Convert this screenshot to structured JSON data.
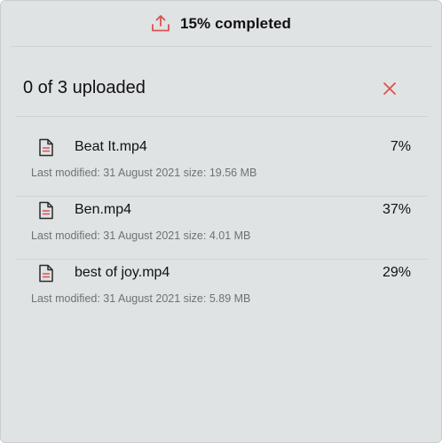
{
  "header": {
    "icon": "upload-icon",
    "title": "15% completed",
    "accent_color": "#d9534f"
  },
  "summary": {
    "text": "0 of 3 uploaded",
    "close_icon": "close-icon"
  },
  "files": [
    {
      "icon": "document-icon",
      "name": "Beat It.mp4",
      "percent": "7%",
      "meta": "Last modified: 31 August 2021 size: 19.56 MB"
    },
    {
      "icon": "document-icon",
      "name": "Ben.mp4",
      "percent": "37%",
      "meta": "Last modified: 31 August 2021 size: 4.01 MB"
    },
    {
      "icon": "document-icon",
      "name": "best of joy.mp4",
      "percent": "29%",
      "meta": "Last modified: 31 August 2021 size: 5.89 MB"
    }
  ]
}
